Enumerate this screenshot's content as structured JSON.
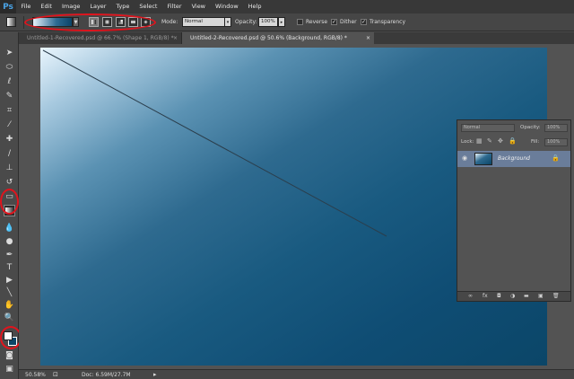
{
  "app": {
    "logo": "Ps"
  },
  "menu": [
    "File",
    "Edit",
    "Image",
    "Layer",
    "Type",
    "Select",
    "Filter",
    "View",
    "Window",
    "Help"
  ],
  "options": {
    "mode_label": "Mode:",
    "mode_value": "Normal",
    "opacity_label": "Opacity:",
    "opacity_value": "100%",
    "reverse_label": "Reverse",
    "dither_label": "Dither",
    "transparency_label": "Transparency",
    "reverse_checked": false,
    "dither_checked": true,
    "transparency_checked": true
  },
  "tabs": [
    {
      "label": "Untitled-1-Recovered.psd @ 66.7% (Shape 1, RGB/8) *",
      "close": "×"
    },
    {
      "label": "Untitled-2-Recovered.psd @ 50.6% (Background, RGB/8) *",
      "close": "×"
    }
  ],
  "status": {
    "zoom": "50.58%",
    "doc": "Doc: 6.59M/27.7M"
  },
  "layers_panel": {
    "blend_mode": "Normal",
    "opacity_label": "Opacity:",
    "opacity_value": "100%",
    "lock_label": "Lock:",
    "fill_label": "Fill:",
    "fill_value": "100%",
    "layer_name": "Background"
  },
  "colors": {
    "highlight": "#e0141d",
    "gradient_start": "#e9f5fd",
    "gradient_end": "#0b4668"
  }
}
